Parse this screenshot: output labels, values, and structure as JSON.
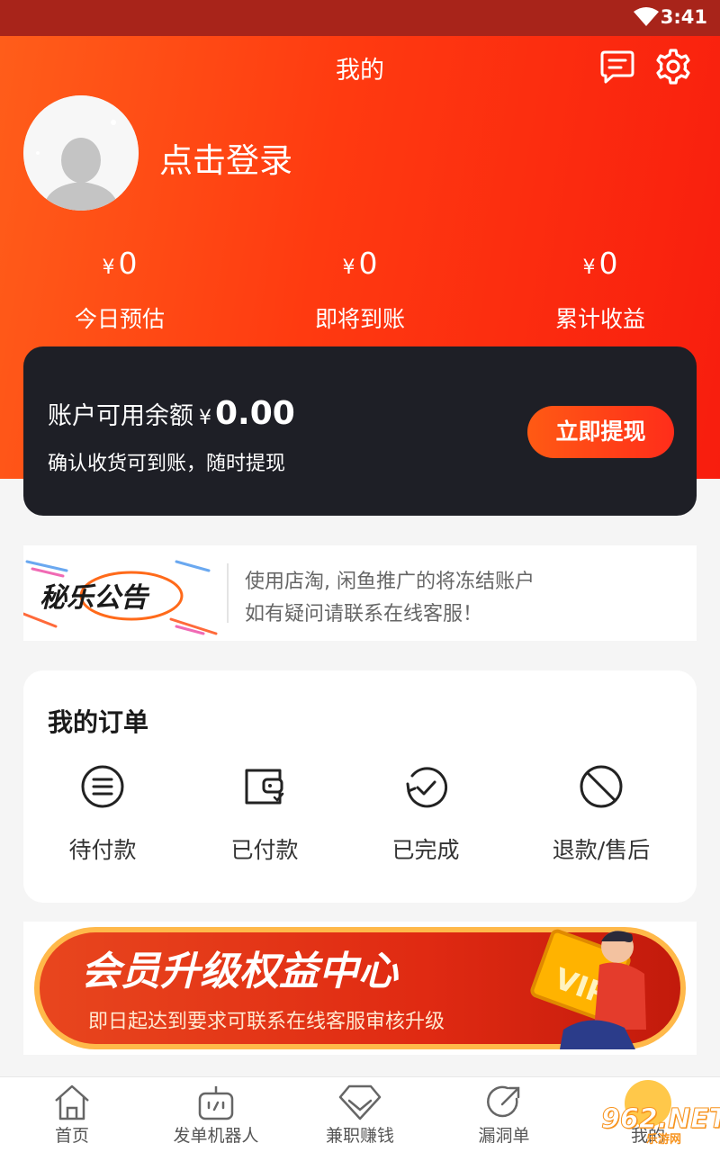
{
  "status_bar": {
    "time": "3:41"
  },
  "header": {
    "title": "我的"
  },
  "profile": {
    "login_text": "点击登录"
  },
  "stats": [
    {
      "currency": "¥",
      "amount": "0",
      "label": "今日预估"
    },
    {
      "currency": "¥",
      "amount": "0",
      "label": "即将到账"
    },
    {
      "currency": "¥",
      "amount": "0",
      "label": "累计收益"
    }
  ],
  "balance": {
    "label": "账户可用余额",
    "currency": "¥",
    "amount": "0.00",
    "subtitle": "确认收货可到账，随时提现",
    "button": "立即提现"
  },
  "notice": {
    "logo_text": "秘乐公告",
    "line1": "使用店淘, 闲鱼推广的将冻结账户",
    "line2": "如有疑问请联系在线客服！"
  },
  "orders": {
    "title": "我的订单",
    "items": [
      {
        "label": "待付款",
        "icon": "list-circle-icon"
      },
      {
        "label": "已付款",
        "icon": "wallet-icon"
      },
      {
        "label": "已完成",
        "icon": "check-refresh-icon"
      },
      {
        "label": "退款/售后",
        "icon": "forbidden-icon"
      }
    ]
  },
  "vip_banner": {
    "title": "会员升级权益中心",
    "subtitle": "即日起达到要求可联系在线客服审核升级",
    "badge": "VIP"
  },
  "tabbar": {
    "items": [
      {
        "label": "首页",
        "icon": "home-icon"
      },
      {
        "label": "发单机器人",
        "icon": "robot-icon"
      },
      {
        "label": "兼职赚钱",
        "icon": "diamond-icon"
      },
      {
        "label": "漏洞单",
        "icon": "share-icon"
      },
      {
        "label": "我的",
        "icon": "user-icon"
      }
    ]
  },
  "watermark": {
    "text": "962.NET",
    "subtext": "乐游网"
  },
  "colors": {
    "accent": "#ff3a10",
    "card_dark": "#1e1f26"
  }
}
